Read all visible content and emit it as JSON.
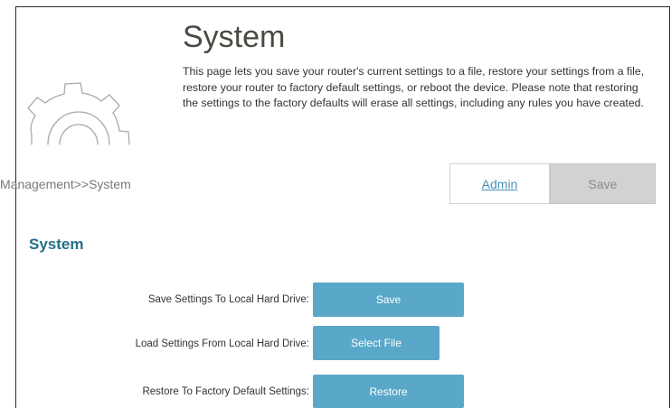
{
  "header": {
    "title": "System",
    "description": "This page lets you save your router's current settings to a file, restore your settings from a file, restore your router to factory default settings, or reboot the device. Please note that restoring the settings to the factory defaults will erase all settings, including any rules you have created."
  },
  "breadcrumb": "Management>>System",
  "tabs": {
    "admin_label": "Admin",
    "save_label": "Save"
  },
  "section": {
    "title": "System",
    "rows": [
      {
        "label": "Save Settings To Local Hard Drive:",
        "button": "Save"
      },
      {
        "label": "Load Settings From Local Hard Drive:",
        "button": "Select File"
      },
      {
        "label": "Restore To Factory Default Settings:",
        "button": "Restore"
      }
    ]
  },
  "icons": {
    "header_icon": "gear-icon"
  },
  "colors": {
    "accent": "#5aa8c9",
    "section_title": "#236f8a",
    "link": "#4a90b8",
    "disabled_tab": "#d2d2d2"
  }
}
